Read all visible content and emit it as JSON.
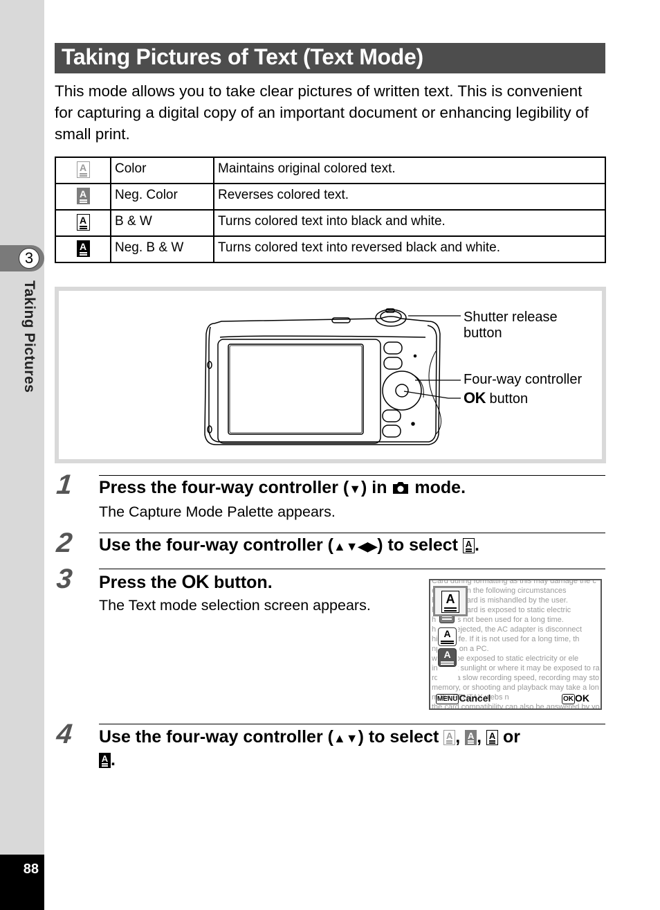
{
  "sidebar": {
    "chapter_number": "3",
    "chapter_title": "Taking Pictures",
    "page_number": "88"
  },
  "header": {
    "title": "Taking Pictures of Text (Text Mode)"
  },
  "intro": "This mode allows you to take clear pictures of written text. This is convenient for capturing a digital copy of an important document or enhancing legibility of small print.",
  "modes_table": {
    "rows": [
      {
        "icon": "text-color-icon",
        "name": "Color",
        "description": "Maintains original colored text."
      },
      {
        "icon": "text-neg-color-icon",
        "name": "Neg. Color",
        "description": "Reverses colored text."
      },
      {
        "icon": "text-bw-icon",
        "name": "B & W",
        "description": "Turns colored text into black and white."
      },
      {
        "icon": "text-neg-bw-icon",
        "name": "Neg. B & W",
        "description": "Turns colored text into reversed black and white."
      }
    ]
  },
  "figure": {
    "callouts": {
      "shutter": [
        "Shutter release",
        "button"
      ],
      "four_way": "Four-way controller",
      "ok_glyph": "OK",
      "ok_suffix": " button"
    }
  },
  "steps": [
    {
      "number": "1",
      "title_before": "Press the four-way controller (",
      "arrows": "▼",
      "title_middle": ") in ",
      "camera_icon": "camera-mode-icon",
      "title_after": " mode.",
      "subtitle": "The Capture Mode Palette appears."
    },
    {
      "number": "2",
      "title_before": "Use the four-way controller (",
      "arrows": "▲▼◀▶",
      "title_after": ") to select ",
      "end": "."
    },
    {
      "number": "3",
      "title_before": "Press the ",
      "ok_glyph": "OK",
      "title_after": " button.",
      "subtitle": "The Text mode selection screen appears."
    },
    {
      "number": "4",
      "title_before": "Use the four-way controller (",
      "arrows": "▲▼",
      "title_after": ") to select ",
      "sep1": ", ",
      "sep2": ", ",
      "sep3": " or",
      "end": "."
    }
  ],
  "screen": {
    "background_lines": [
      "Card during formatting as this may damage the c",
      "e        deleted in the following circumstances",
      "h        emory Card is mishandled by the user.",
      "h        emory Card is exposed to static electric",
      "h t      d has not been used for a long time.",
      "h t      d is ejected, the AC adapter is disconnect",
      "hi       vice life. If it is not used for a long time, th",
      "np       data on a PC.",
      "w        may be exposed to static electricity or ele",
      "in direct sunlight or where it may be exposed to ra",
      "rd with a slow recording speed, recording may sto",
      "memory, or shooting and playback may take a lon",
      "m                    the PENTAX webs           n",
      "the card compatibility can also be answered by yo"
    ],
    "menu_badge": "MENU",
    "cancel_label": "Cancel",
    "ok_badge": "OK",
    "ok_label": "OK"
  }
}
